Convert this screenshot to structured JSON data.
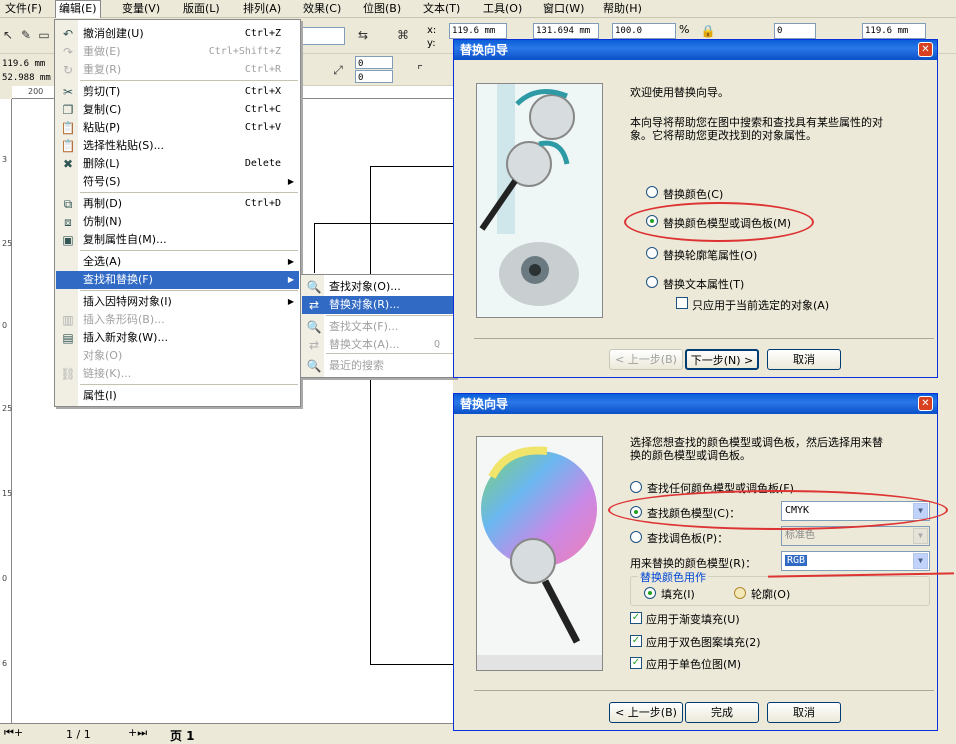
{
  "menubar": [
    "文件(F)",
    "编辑(E)",
    "变量(V)",
    "版面(L)",
    "排列(A)",
    "效果(C)",
    "位图(B)",
    "文本(T)",
    "工具(O)",
    "窗口(W)",
    "帮助(H)"
  ],
  "toolbar": {
    "x_label": "x:",
    "y_label": "y:",
    "width_value": "119.6 mm",
    "height_value": "131.694 mm",
    "scale_value": "100.0",
    "percent": "%",
    "rotate_value": "0",
    "right_width": "119.6 mm",
    "left_w": "119.6 mm",
    "left_h": "52.988 mm",
    "nudge_a": "0",
    "nudge_b": "0"
  },
  "ruler_top": [
    "200"
  ],
  "ruler_left": [
    "3",
    "25",
    "0",
    "25",
    "15",
    "0",
    "6"
  ],
  "status": {
    "page_pos": "1 / 1",
    "page_tab": "页 1"
  },
  "edit_menu": [
    {
      "label": "撤消创建(U)",
      "shortcut": "Ctrl+Z",
      "icon": "undo-icon"
    },
    {
      "label": "重做(E)",
      "shortcut": "Ctrl+Shift+Z",
      "icon": "redo-icon",
      "disabled": true
    },
    {
      "label": "重复(R)",
      "shortcut": "Ctrl+R",
      "icon": "repeat-icon",
      "disabled": true
    },
    {
      "label": "剪切(T)",
      "shortcut": "Ctrl+X",
      "icon": "scissors-icon"
    },
    {
      "label": "复制(C)",
      "shortcut": "Ctrl+C",
      "icon": "copy-icon"
    },
    {
      "label": "粘贴(P)",
      "shortcut": "Ctrl+V",
      "icon": "paste-icon"
    },
    {
      "label": "选择性粘贴(S)...",
      "shortcut": "",
      "icon": "paste-special-icon"
    },
    {
      "label": "删除(L)",
      "shortcut": "Delete",
      "icon": "delete-icon"
    },
    {
      "label": "符号(S)",
      "shortcut": "",
      "icon": "",
      "submenu": true
    },
    {
      "label": "再制(D)",
      "shortcut": "Ctrl+D",
      "icon": "duplicate-icon"
    },
    {
      "label": "仿制(N)",
      "shortcut": "",
      "icon": "clone-icon"
    },
    {
      "label": "复制属性自(M)...",
      "shortcut": "",
      "icon": "copy-properties-icon"
    },
    {
      "label": "全选(A)",
      "shortcut": "",
      "icon": "",
      "submenu": true
    },
    {
      "label": "查找和替换(F)",
      "shortcut": "",
      "icon": "",
      "submenu": true,
      "highlighted": true
    },
    {
      "label": "插入因特网对象(I)",
      "shortcut": "",
      "icon": "",
      "submenu": true
    },
    {
      "label": "插入条形码(B)...",
      "shortcut": "",
      "icon": "barcode-icon",
      "disabled": true
    },
    {
      "label": "插入新对象(W)...",
      "shortcut": "",
      "icon": "insert-object-icon"
    },
    {
      "label": "对象(O)",
      "shortcut": "",
      "icon": "",
      "disabled": true
    },
    {
      "label": "链接(K)...",
      "shortcut": "",
      "icon": "ole-link-icon",
      "disabled": true
    },
    {
      "label": "属性(I)",
      "shortcut": "",
      "icon": ""
    }
  ],
  "find_submenu": [
    {
      "label": "查找对象(O)...",
      "icon": "find-objects-icon"
    },
    {
      "label": "替换对象(R)...",
      "icon": "replace-objects-icon",
      "highlighted": true
    },
    {
      "label": "查找文本(F)...",
      "icon": "find-text-icon",
      "disabled": true
    },
    {
      "label": "替换文本(A)...",
      "icon": "replace-text-icon",
      "disabled": true,
      "shortcut": "Q"
    },
    {
      "label": "最近的搜索",
      "icon": "recent-search-icon",
      "disabled": true
    }
  ],
  "dialog1": {
    "title": "替换向导",
    "intro": "欢迎使用替换向导。",
    "desc_line1": "本向导将帮助您在图中搜索和查找具有某些属性的对",
    "desc_line2": "象。它将帮助您更改找到的对象属性。",
    "options": [
      "替换颜色(C)",
      "替换颜色模型或调色板(M)",
      "替换轮廓笔属性(O)",
      "替换文本属性(T)"
    ],
    "selected_index": 1,
    "only_selected": "只应用于当前选定的对象(A)",
    "back": "< 上一步(B)",
    "next": "下一步(N) >",
    "cancel": "取消"
  },
  "dialog2": {
    "title": "替换向导",
    "desc_line1": "选择您想查找的颜色模型或调色板，然后选择用来替",
    "desc_line2": "换的颜色模型或调色板。",
    "find_any": "查找任何颜色模型或调色板(F)",
    "find_model": "查找颜色模型(C)：",
    "find_model_value": "CMYK",
    "find_palette": "查找调色板(P)：",
    "find_palette_value": "标准色",
    "replace_with": "用来替换的颜色模型(R)：",
    "replace_value": "RGB",
    "group_title": "替换颜色用作",
    "fill": "填充(I)",
    "outline": "轮廓(O)",
    "apply1": "应用于渐变填充(U)",
    "apply2": "应用于双色图案填充(2)",
    "apply3": "应用于单色位图(M)",
    "back": "< 上一步(B)",
    "finish": "完成",
    "cancel": "取消"
  },
  "colors": {
    "highlight": "#316ac5",
    "title_blue": "#0a5fd8",
    "red_marker": "#d33333"
  }
}
